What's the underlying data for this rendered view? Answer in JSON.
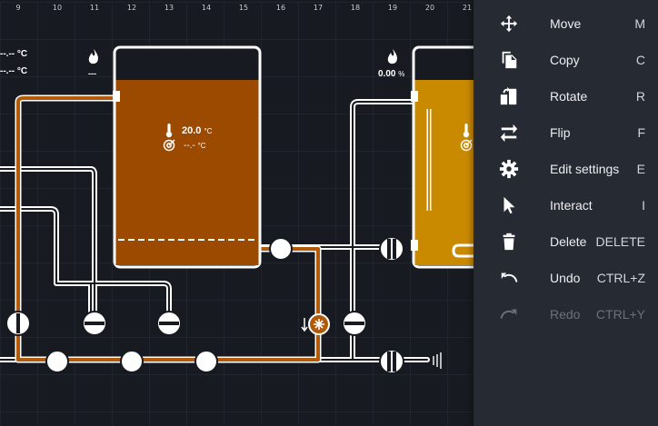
{
  "grid": {
    "column_labels": [
      "9",
      "10",
      "11",
      "12",
      "13",
      "14",
      "15",
      "16",
      "17",
      "18",
      "19",
      "20",
      "21"
    ]
  },
  "builder": {
    "left_edge_readout_1": "--.-- °C",
    "left_edge_readout_2": "--.-- °C",
    "burner_left_value": "---",
    "burner_right_value": "0.00",
    "burner_right_unit": "%",
    "kettle_temp_value": "20.0",
    "kettle_temp_unit": "°C",
    "kettle_setpoint_value": "--.-",
    "kettle_setpoint_unit": "°C",
    "kettle_color": "#9c4a00",
    "vessel2_color": "#c98a00",
    "tube_color": "#b05a0a"
  },
  "menu": {
    "items": [
      {
        "label": "Move",
        "key": "M",
        "icon": "move-arrows-icon"
      },
      {
        "label": "Copy",
        "key": "C",
        "icon": "copy-icon"
      },
      {
        "label": "Rotate",
        "key": "R",
        "icon": "rotate-icon"
      },
      {
        "label": "Flip",
        "key": "F",
        "icon": "flip-arrows-icon"
      },
      {
        "label": "Edit settings",
        "key": "E",
        "icon": "gear-icon"
      },
      {
        "label": "Interact",
        "key": "I",
        "icon": "cursor-icon"
      },
      {
        "label": "Delete",
        "key": "DELETE",
        "icon": "trash-icon"
      },
      {
        "label": "Undo",
        "key": "CTRL+Z",
        "icon": "undo-icon"
      },
      {
        "label": "Redo",
        "key": "CTRL+Y",
        "icon": "redo-icon"
      }
    ]
  }
}
